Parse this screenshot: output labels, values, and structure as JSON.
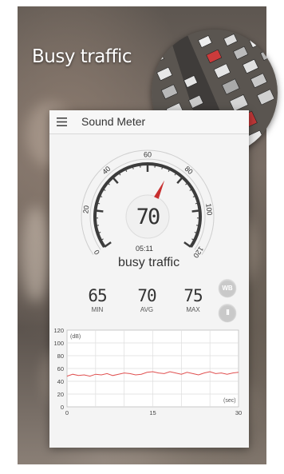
{
  "promo": {
    "headline": "Busy traffic"
  },
  "app": {
    "title": "Sound Meter"
  },
  "gauge": {
    "value": "70",
    "ticks": [
      "0",
      "20",
      "40",
      "60",
      "80",
      "100",
      "120"
    ],
    "needle_db": 72
  },
  "timer": "05:11",
  "status": "busy traffic",
  "stats": {
    "min": {
      "value": "65",
      "label": "MIN"
    },
    "avg": {
      "value": "70",
      "label": "AVG"
    },
    "max": {
      "value": "75",
      "label": "MAX"
    }
  },
  "buttons": {
    "weighting_label": "WB",
    "pause_label": "II"
  },
  "chart_data": {
    "type": "line",
    "ylabel": "(dB)",
    "xlabel": "(sec)",
    "ylim": [
      0,
      120
    ],
    "xlim": [
      0,
      30
    ],
    "yticks": [
      "0",
      "20",
      "40",
      "60",
      "80",
      "100",
      "120"
    ],
    "xticks": [
      "0",
      "15",
      "30"
    ],
    "grid": true,
    "line_color": "#e05050",
    "series": [
      {
        "x": [
          0,
          1,
          2,
          3,
          4,
          5,
          6,
          7,
          8,
          9,
          10,
          11,
          12,
          13,
          14,
          15,
          16,
          17,
          18,
          19,
          20,
          21,
          22,
          23,
          24,
          25,
          26,
          27,
          28,
          29,
          30
        ],
        "values": [
          48,
          51,
          49,
          50,
          48,
          51,
          50,
          52,
          49,
          51,
          53,
          52,
          50,
          51,
          54,
          55,
          53,
          52,
          55,
          53,
          51,
          54,
          52,
          50,
          53,
          55,
          52,
          53,
          51,
          53,
          54
        ]
      }
    ]
  }
}
